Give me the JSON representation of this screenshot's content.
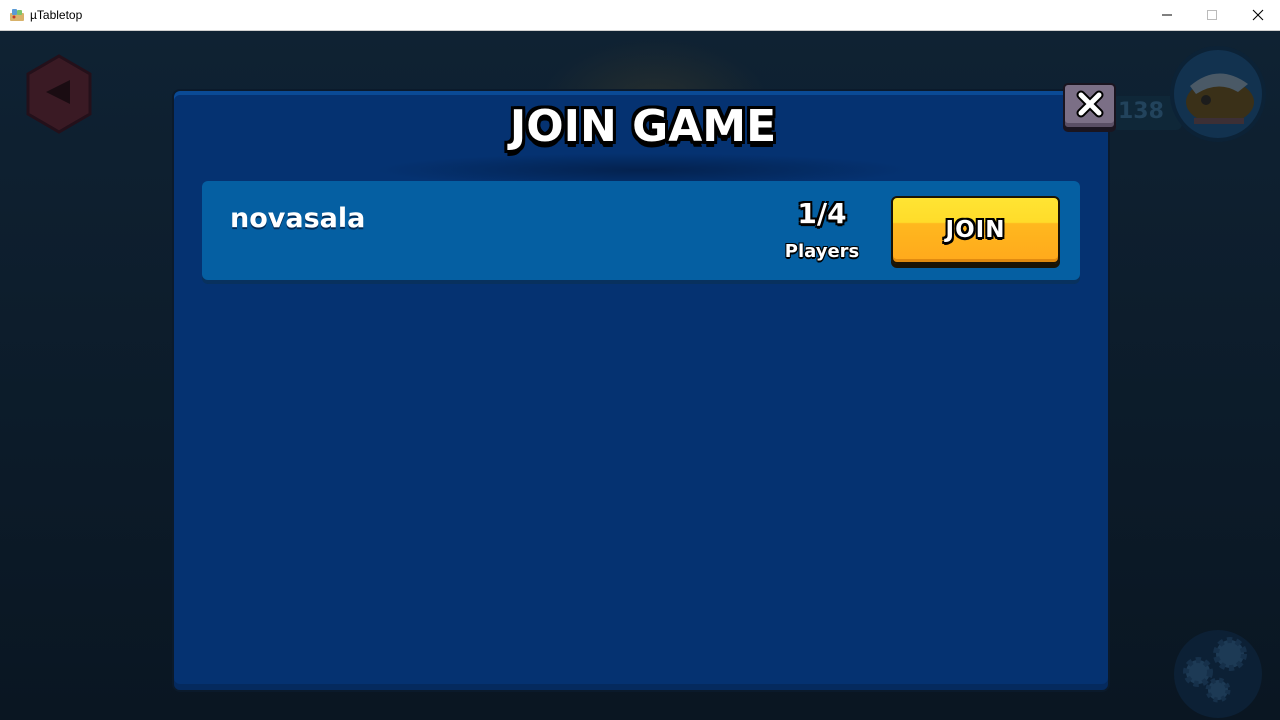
{
  "window": {
    "title": "µTabletop",
    "app_icon": "tabletop-app-icon",
    "controls": [
      "minimize-icon",
      "maximize-icon",
      "close-icon"
    ]
  },
  "background": {
    "back_icon": "back-arrow-icon",
    "trophies": "138",
    "avatar_icon": "player-avatar-icon",
    "settings_icon": "settings-gears-icon"
  },
  "dialog": {
    "title": "JOIN GAME",
    "close_icon": "close-x-icon"
  },
  "rooms": [
    {
      "name": "novasala",
      "count": "1/4",
      "players_label": "Players",
      "join_label": "JOIN"
    }
  ],
  "colors": {
    "dialog_bg": "#053271",
    "card_bg": "#055fa2",
    "join_yellow": "#ffd42a",
    "close_btn": "#7b6f86"
  }
}
